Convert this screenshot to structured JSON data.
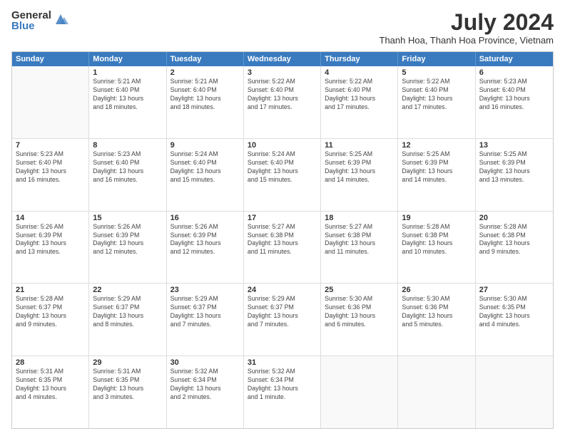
{
  "header": {
    "logo_general": "General",
    "logo_blue": "Blue",
    "month_year": "July 2024",
    "location": "Thanh Hoa, Thanh Hoa Province, Vietnam"
  },
  "weekdays": [
    "Sunday",
    "Monday",
    "Tuesday",
    "Wednesday",
    "Thursday",
    "Friday",
    "Saturday"
  ],
  "weeks": [
    [
      {
        "day": "",
        "info": ""
      },
      {
        "day": "1",
        "info": "Sunrise: 5:21 AM\nSunset: 6:40 PM\nDaylight: 13 hours\nand 18 minutes."
      },
      {
        "day": "2",
        "info": "Sunrise: 5:21 AM\nSunset: 6:40 PM\nDaylight: 13 hours\nand 18 minutes."
      },
      {
        "day": "3",
        "info": "Sunrise: 5:22 AM\nSunset: 6:40 PM\nDaylight: 13 hours\nand 17 minutes."
      },
      {
        "day": "4",
        "info": "Sunrise: 5:22 AM\nSunset: 6:40 PM\nDaylight: 13 hours\nand 17 minutes."
      },
      {
        "day": "5",
        "info": "Sunrise: 5:22 AM\nSunset: 6:40 PM\nDaylight: 13 hours\nand 17 minutes."
      },
      {
        "day": "6",
        "info": "Sunrise: 5:23 AM\nSunset: 6:40 PM\nDaylight: 13 hours\nand 16 minutes."
      }
    ],
    [
      {
        "day": "7",
        "info": "Sunrise: 5:23 AM\nSunset: 6:40 PM\nDaylight: 13 hours\nand 16 minutes."
      },
      {
        "day": "8",
        "info": "Sunrise: 5:23 AM\nSunset: 6:40 PM\nDaylight: 13 hours\nand 16 minutes."
      },
      {
        "day": "9",
        "info": "Sunrise: 5:24 AM\nSunset: 6:40 PM\nDaylight: 13 hours\nand 15 minutes."
      },
      {
        "day": "10",
        "info": "Sunrise: 5:24 AM\nSunset: 6:40 PM\nDaylight: 13 hours\nand 15 minutes."
      },
      {
        "day": "11",
        "info": "Sunrise: 5:25 AM\nSunset: 6:39 PM\nDaylight: 13 hours\nand 14 minutes."
      },
      {
        "day": "12",
        "info": "Sunrise: 5:25 AM\nSunset: 6:39 PM\nDaylight: 13 hours\nand 14 minutes."
      },
      {
        "day": "13",
        "info": "Sunrise: 5:25 AM\nSunset: 6:39 PM\nDaylight: 13 hours\nand 13 minutes."
      }
    ],
    [
      {
        "day": "14",
        "info": "Sunrise: 5:26 AM\nSunset: 6:39 PM\nDaylight: 13 hours\nand 13 minutes."
      },
      {
        "day": "15",
        "info": "Sunrise: 5:26 AM\nSunset: 6:39 PM\nDaylight: 13 hours\nand 12 minutes."
      },
      {
        "day": "16",
        "info": "Sunrise: 5:26 AM\nSunset: 6:39 PM\nDaylight: 13 hours\nand 12 minutes."
      },
      {
        "day": "17",
        "info": "Sunrise: 5:27 AM\nSunset: 6:38 PM\nDaylight: 13 hours\nand 11 minutes."
      },
      {
        "day": "18",
        "info": "Sunrise: 5:27 AM\nSunset: 6:38 PM\nDaylight: 13 hours\nand 11 minutes."
      },
      {
        "day": "19",
        "info": "Sunrise: 5:28 AM\nSunset: 6:38 PM\nDaylight: 13 hours\nand 10 minutes."
      },
      {
        "day": "20",
        "info": "Sunrise: 5:28 AM\nSunset: 6:38 PM\nDaylight: 13 hours\nand 9 minutes."
      }
    ],
    [
      {
        "day": "21",
        "info": "Sunrise: 5:28 AM\nSunset: 6:37 PM\nDaylight: 13 hours\nand 9 minutes."
      },
      {
        "day": "22",
        "info": "Sunrise: 5:29 AM\nSunset: 6:37 PM\nDaylight: 13 hours\nand 8 minutes."
      },
      {
        "day": "23",
        "info": "Sunrise: 5:29 AM\nSunset: 6:37 PM\nDaylight: 13 hours\nand 7 minutes."
      },
      {
        "day": "24",
        "info": "Sunrise: 5:29 AM\nSunset: 6:37 PM\nDaylight: 13 hours\nand 7 minutes."
      },
      {
        "day": "25",
        "info": "Sunrise: 5:30 AM\nSunset: 6:36 PM\nDaylight: 13 hours\nand 6 minutes."
      },
      {
        "day": "26",
        "info": "Sunrise: 5:30 AM\nSunset: 6:36 PM\nDaylight: 13 hours\nand 5 minutes."
      },
      {
        "day": "27",
        "info": "Sunrise: 5:30 AM\nSunset: 6:35 PM\nDaylight: 13 hours\nand 4 minutes."
      }
    ],
    [
      {
        "day": "28",
        "info": "Sunrise: 5:31 AM\nSunset: 6:35 PM\nDaylight: 13 hours\nand 4 minutes."
      },
      {
        "day": "29",
        "info": "Sunrise: 5:31 AM\nSunset: 6:35 PM\nDaylight: 13 hours\nand 3 minutes."
      },
      {
        "day": "30",
        "info": "Sunrise: 5:32 AM\nSunset: 6:34 PM\nDaylight: 13 hours\nand 2 minutes."
      },
      {
        "day": "31",
        "info": "Sunrise: 5:32 AM\nSunset: 6:34 PM\nDaylight: 13 hours\nand 1 minute."
      },
      {
        "day": "",
        "info": ""
      },
      {
        "day": "",
        "info": ""
      },
      {
        "day": "",
        "info": ""
      }
    ]
  ]
}
